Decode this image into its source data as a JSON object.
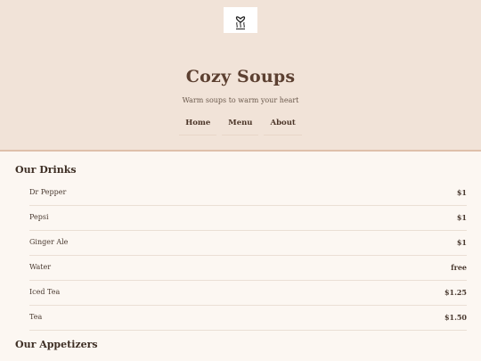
{
  "header": {
    "logo_icon": "cup-heart-logo",
    "title": "Cozy Soups",
    "subtitle": "Warm soups to warm your heart",
    "nav": [
      {
        "label": "Home"
      },
      {
        "label": "Menu"
      },
      {
        "label": "About"
      }
    ]
  },
  "drinks": {
    "heading": "Our Drinks",
    "items": [
      {
        "name": "Dr Pepper",
        "price": "$1"
      },
      {
        "name": "Pepsi",
        "price": "$1"
      },
      {
        "name": "Ginger Ale",
        "price": "$1"
      },
      {
        "name": "Water",
        "price": "free"
      },
      {
        "name": "Iced Tea",
        "price": "$1.25"
      },
      {
        "name": "Tea",
        "price": "$1.50"
      }
    ]
  },
  "appetizers": {
    "heading": "Our Appetizers"
  },
  "colors": {
    "header_bg": "#f1e3d8",
    "page_bg": "#fcf7f2",
    "accent": "#5c4031"
  }
}
